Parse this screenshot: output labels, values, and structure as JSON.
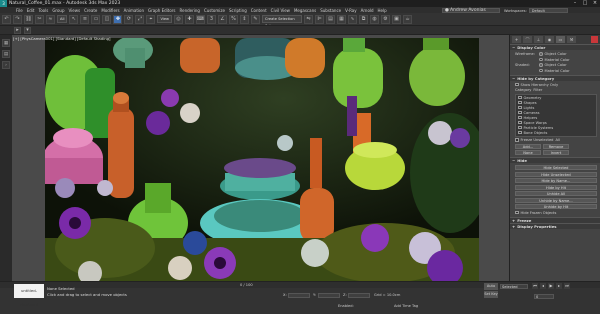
{
  "app": {
    "title": "Natural_Coffee_01.max - Autodesk 3ds Max 2023",
    "logo_text": "3"
  },
  "menus": [
    "File",
    "Edit",
    "Tools",
    "Group",
    "Views",
    "Create",
    "Modifiers",
    "Animation",
    "Graph Editors",
    "Rendering",
    "Customize",
    "Scripting",
    "Content",
    "Civil View",
    "Megascans",
    "Substance",
    "V-Ray",
    "Arnold",
    "Help"
  ],
  "signin": {
    "label": "Andrew Avonias"
  },
  "workspace": {
    "label": "Workspaces:",
    "value": "Default"
  },
  "toolbar": {
    "filter_dropdown": "All",
    "view_dropdown": "View",
    "selection_set": "Create Selection Set"
  },
  "viewport": {
    "label": "[+] [PhysCamera001] [Standard] [Default Shading]"
  },
  "command_panel": {
    "display_color": {
      "title": "Display Color",
      "wireframe_label": "Wireframe:",
      "shaded_label": "Shaded:",
      "options": [
        "Object Color",
        "Material Color"
      ],
      "wireframe_selected": "Object Color",
      "shaded_selected": "Object Color"
    },
    "hide_by_category": {
      "title": "Hide by Category",
      "hide_note": "Show Hierarchy Only",
      "category_label": "Category",
      "filter_label": "Filter",
      "categories": [
        "Geometry",
        "Shapes",
        "Lights",
        "Cameras",
        "Helpers",
        "Space Warps",
        "Particle Systems",
        "Bone Objects"
      ],
      "checked": [
        false,
        false,
        false,
        false,
        false,
        false,
        false,
        false
      ],
      "frozen_label": "Freeze Unselected",
      "all_label": "All",
      "add_label": "Add...",
      "remove_label": "Remove",
      "none_label": "None",
      "invert_label": "Invert"
    },
    "hide": {
      "title": "Hide",
      "buttons": [
        "Hide Selected",
        "Hide Unselected",
        "Hide by Name...",
        "Hide by Hit",
        "Unhide All",
        "Unhide by Name...",
        "Unhide by Hit"
      ],
      "checkbox": "Hide Frozen Objects"
    },
    "freeze": {
      "title": "Freeze"
    },
    "display_properties": {
      "title": "Display Properties"
    }
  },
  "timeline": {
    "frame_range": "0 / 100"
  },
  "status": {
    "maxscript_label": "untitled-MaxScript",
    "selection": "None Selected",
    "prompt": "Click and drag to select and move objects",
    "x_label": "X:",
    "y_label": "Y:",
    "z_label": "Z:",
    "grid": "Grid = 10.0cm",
    "autokey": "Auto Key",
    "set_key": "Set Key",
    "selected": "Selected",
    "add_time_tag": "Add Time Tag",
    "enabled": "Enabled:",
    "frame": "0"
  }
}
